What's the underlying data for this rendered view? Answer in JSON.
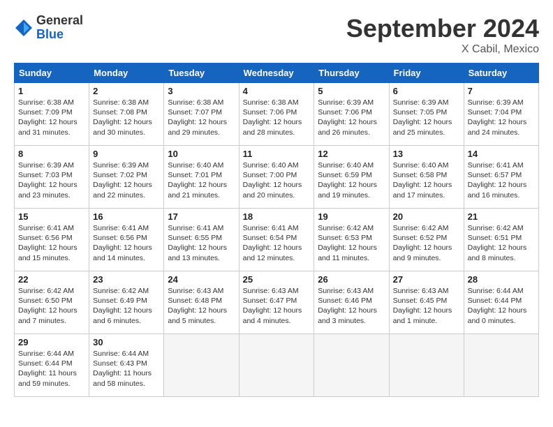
{
  "logo": {
    "general": "General",
    "blue": "Blue"
  },
  "title": "September 2024",
  "location": "X Cabil, Mexico",
  "days_header": [
    "Sunday",
    "Monday",
    "Tuesday",
    "Wednesday",
    "Thursday",
    "Friday",
    "Saturday"
  ],
  "weeks": [
    [
      {
        "day": "1",
        "info": "Sunrise: 6:38 AM\nSunset: 7:09 PM\nDaylight: 12 hours\nand 31 minutes."
      },
      {
        "day": "2",
        "info": "Sunrise: 6:38 AM\nSunset: 7:08 PM\nDaylight: 12 hours\nand 30 minutes."
      },
      {
        "day": "3",
        "info": "Sunrise: 6:38 AM\nSunset: 7:07 PM\nDaylight: 12 hours\nand 29 minutes."
      },
      {
        "day": "4",
        "info": "Sunrise: 6:38 AM\nSunset: 7:06 PM\nDaylight: 12 hours\nand 28 minutes."
      },
      {
        "day": "5",
        "info": "Sunrise: 6:39 AM\nSunset: 7:06 PM\nDaylight: 12 hours\nand 26 minutes."
      },
      {
        "day": "6",
        "info": "Sunrise: 6:39 AM\nSunset: 7:05 PM\nDaylight: 12 hours\nand 25 minutes."
      },
      {
        "day": "7",
        "info": "Sunrise: 6:39 AM\nSunset: 7:04 PM\nDaylight: 12 hours\nand 24 minutes."
      }
    ],
    [
      {
        "day": "8",
        "info": "Sunrise: 6:39 AM\nSunset: 7:03 PM\nDaylight: 12 hours\nand 23 minutes."
      },
      {
        "day": "9",
        "info": "Sunrise: 6:39 AM\nSunset: 7:02 PM\nDaylight: 12 hours\nand 22 minutes."
      },
      {
        "day": "10",
        "info": "Sunrise: 6:40 AM\nSunset: 7:01 PM\nDaylight: 12 hours\nand 21 minutes."
      },
      {
        "day": "11",
        "info": "Sunrise: 6:40 AM\nSunset: 7:00 PM\nDaylight: 12 hours\nand 20 minutes."
      },
      {
        "day": "12",
        "info": "Sunrise: 6:40 AM\nSunset: 6:59 PM\nDaylight: 12 hours\nand 19 minutes."
      },
      {
        "day": "13",
        "info": "Sunrise: 6:40 AM\nSunset: 6:58 PM\nDaylight: 12 hours\nand 17 minutes."
      },
      {
        "day": "14",
        "info": "Sunrise: 6:41 AM\nSunset: 6:57 PM\nDaylight: 12 hours\nand 16 minutes."
      }
    ],
    [
      {
        "day": "15",
        "info": "Sunrise: 6:41 AM\nSunset: 6:56 PM\nDaylight: 12 hours\nand 15 minutes."
      },
      {
        "day": "16",
        "info": "Sunrise: 6:41 AM\nSunset: 6:56 PM\nDaylight: 12 hours\nand 14 minutes."
      },
      {
        "day": "17",
        "info": "Sunrise: 6:41 AM\nSunset: 6:55 PM\nDaylight: 12 hours\nand 13 minutes."
      },
      {
        "day": "18",
        "info": "Sunrise: 6:41 AM\nSunset: 6:54 PM\nDaylight: 12 hours\nand 12 minutes."
      },
      {
        "day": "19",
        "info": "Sunrise: 6:42 AM\nSunset: 6:53 PM\nDaylight: 12 hours\nand 11 minutes."
      },
      {
        "day": "20",
        "info": "Sunrise: 6:42 AM\nSunset: 6:52 PM\nDaylight: 12 hours\nand 9 minutes."
      },
      {
        "day": "21",
        "info": "Sunrise: 6:42 AM\nSunset: 6:51 PM\nDaylight: 12 hours\nand 8 minutes."
      }
    ],
    [
      {
        "day": "22",
        "info": "Sunrise: 6:42 AM\nSunset: 6:50 PM\nDaylight: 12 hours\nand 7 minutes."
      },
      {
        "day": "23",
        "info": "Sunrise: 6:42 AM\nSunset: 6:49 PM\nDaylight: 12 hours\nand 6 minutes."
      },
      {
        "day": "24",
        "info": "Sunrise: 6:43 AM\nSunset: 6:48 PM\nDaylight: 12 hours\nand 5 minutes."
      },
      {
        "day": "25",
        "info": "Sunrise: 6:43 AM\nSunset: 6:47 PM\nDaylight: 12 hours\nand 4 minutes."
      },
      {
        "day": "26",
        "info": "Sunrise: 6:43 AM\nSunset: 6:46 PM\nDaylight: 12 hours\nand 3 minutes."
      },
      {
        "day": "27",
        "info": "Sunrise: 6:43 AM\nSunset: 6:45 PM\nDaylight: 12 hours\nand 1 minute."
      },
      {
        "day": "28",
        "info": "Sunrise: 6:44 AM\nSunset: 6:44 PM\nDaylight: 12 hours\nand 0 minutes."
      }
    ],
    [
      {
        "day": "29",
        "info": "Sunrise: 6:44 AM\nSunset: 6:44 PM\nDaylight: 11 hours\nand 59 minutes."
      },
      {
        "day": "30",
        "info": "Sunrise: 6:44 AM\nSunset: 6:43 PM\nDaylight: 11 hours\nand 58 minutes."
      },
      {
        "day": "",
        "info": ""
      },
      {
        "day": "",
        "info": ""
      },
      {
        "day": "",
        "info": ""
      },
      {
        "day": "",
        "info": ""
      },
      {
        "day": "",
        "info": ""
      }
    ]
  ]
}
